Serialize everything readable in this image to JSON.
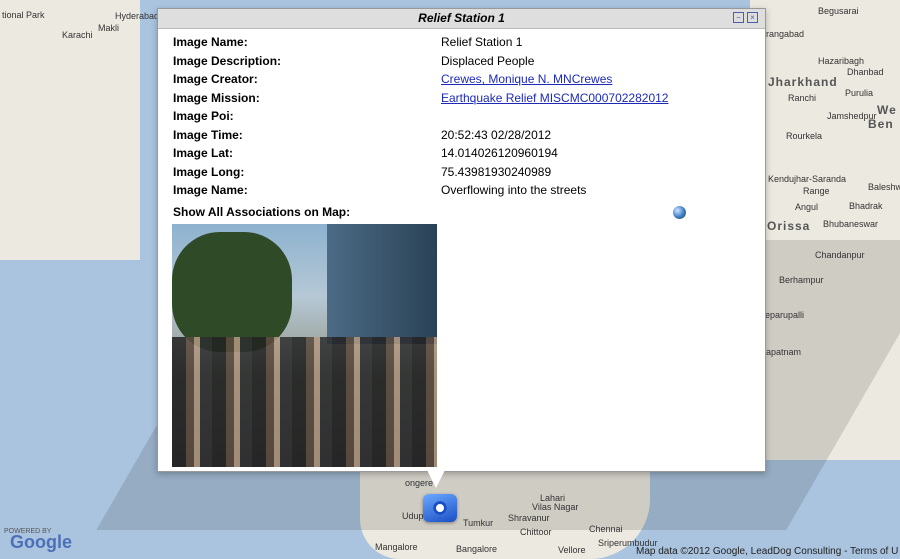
{
  "map": {
    "places": {
      "national_park": "tional Park",
      "hyderabad": "Hyderabad",
      "karachi": "Karachi",
      "makli": "Makli",
      "begusarai": "Begusarai",
      "rangabad": "rangabad",
      "hazaribagh": "Hazaribagh",
      "dhanbad": "Dhanbad",
      "ranchi": "Ranchi",
      "purulia": "Purulia",
      "jamshedpur": "Jamshedpur",
      "rourkela": "Rourkela",
      "kendujhar": "Kendujhar-Saranda",
      "range": "Range",
      "angul": "Angul",
      "bhadrak": "Bhadrak",
      "baleshwar": "Baleshwa",
      "bhubaneswar": "Bhubaneswar",
      "chandanpur": "Chandanpur",
      "berhampur": "Berhampur",
      "eparupalli": "eparupalli",
      "apatnam": "apatnam",
      "mangalore": "Mangalore",
      "bangalore": "Bangalore",
      "vellore": "Vellore",
      "chennai": "Chennai",
      "tumkur": "Tumkur",
      "udupi": "Udupi",
      "shravanur": "Shravanur",
      "lahari": "Lahari",
      "vilas_nagar": "Vilas Nagar",
      "sriperumbudur": "Sriperumbudur",
      "chittoor": "Chittoor",
      "ongere": "ongere"
    },
    "regions": {
      "jharkhand": "Jharkhand",
      "orissa": "Orissa",
      "ben": "Ben",
      "we": "We"
    },
    "powered_by": "POWERED BY",
    "google": "Google",
    "credit": "Map data ©2012 Google, LeadDog Consulting - Terms of U"
  },
  "popup": {
    "title": "Relief Station 1",
    "controls": {
      "minimize": "−",
      "close": "×"
    },
    "rows": [
      {
        "label": "Image Name:",
        "value": "Relief Station 1",
        "link": false
      },
      {
        "label": "Image Description:",
        "value": "Displaced People",
        "link": false
      },
      {
        "label": "Image Creator:",
        "value": "Crewes, Monique N. MNCrewes",
        "link": true
      },
      {
        "label": "Image Mission:",
        "value": "Earthquake Relief MISCMC000702282012",
        "link": true
      },
      {
        "label": "Image Poi:",
        "value": "",
        "link": false
      },
      {
        "label": "Image Time:",
        "value": "20:52:43 02/28/2012",
        "link": false
      },
      {
        "label": "Image Lat:",
        "value": "14.014026120960194",
        "link": false
      },
      {
        "label": "Image Long:",
        "value": "75.43981930240989",
        "link": false
      },
      {
        "label": "Image Name:",
        "value": "Overflowing into the streets",
        "link": false
      }
    ],
    "show_all_label": "Show All Associations on Map:",
    "globe_icon": "globe-icon"
  },
  "marker_icon": "camera-icon"
}
